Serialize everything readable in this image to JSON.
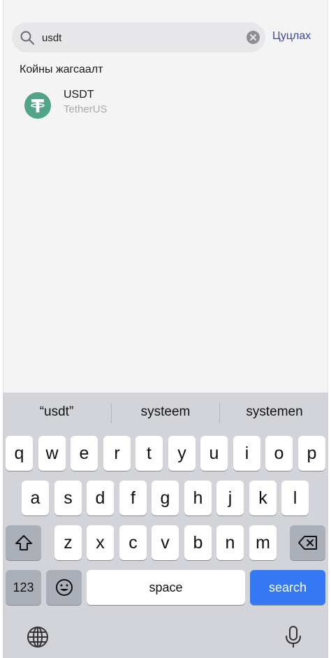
{
  "search": {
    "value": "usdt",
    "cancel_label": "Цуцлах"
  },
  "results": {
    "section_title": "Койны жагсаалт",
    "items": [
      {
        "symbol": "USDT",
        "name": "TetherUS"
      }
    ]
  },
  "keyboard": {
    "suggestions": [
      "“usdt”",
      "systeem",
      "systemen"
    ],
    "row1": [
      "q",
      "w",
      "e",
      "r",
      "t",
      "y",
      "u",
      "i",
      "o",
      "p"
    ],
    "row2": [
      "a",
      "s",
      "d",
      "f",
      "g",
      "h",
      "j",
      "k",
      "l"
    ],
    "row3": [
      "z",
      "x",
      "c",
      "v",
      "b",
      "n",
      "m"
    ],
    "numbers_label": "123",
    "space_label": "space",
    "search_label": "search"
  },
  "colors": {
    "accent": "#3d46a8",
    "tether_green": "#50a487",
    "search_key_blue": "#3478f6"
  }
}
